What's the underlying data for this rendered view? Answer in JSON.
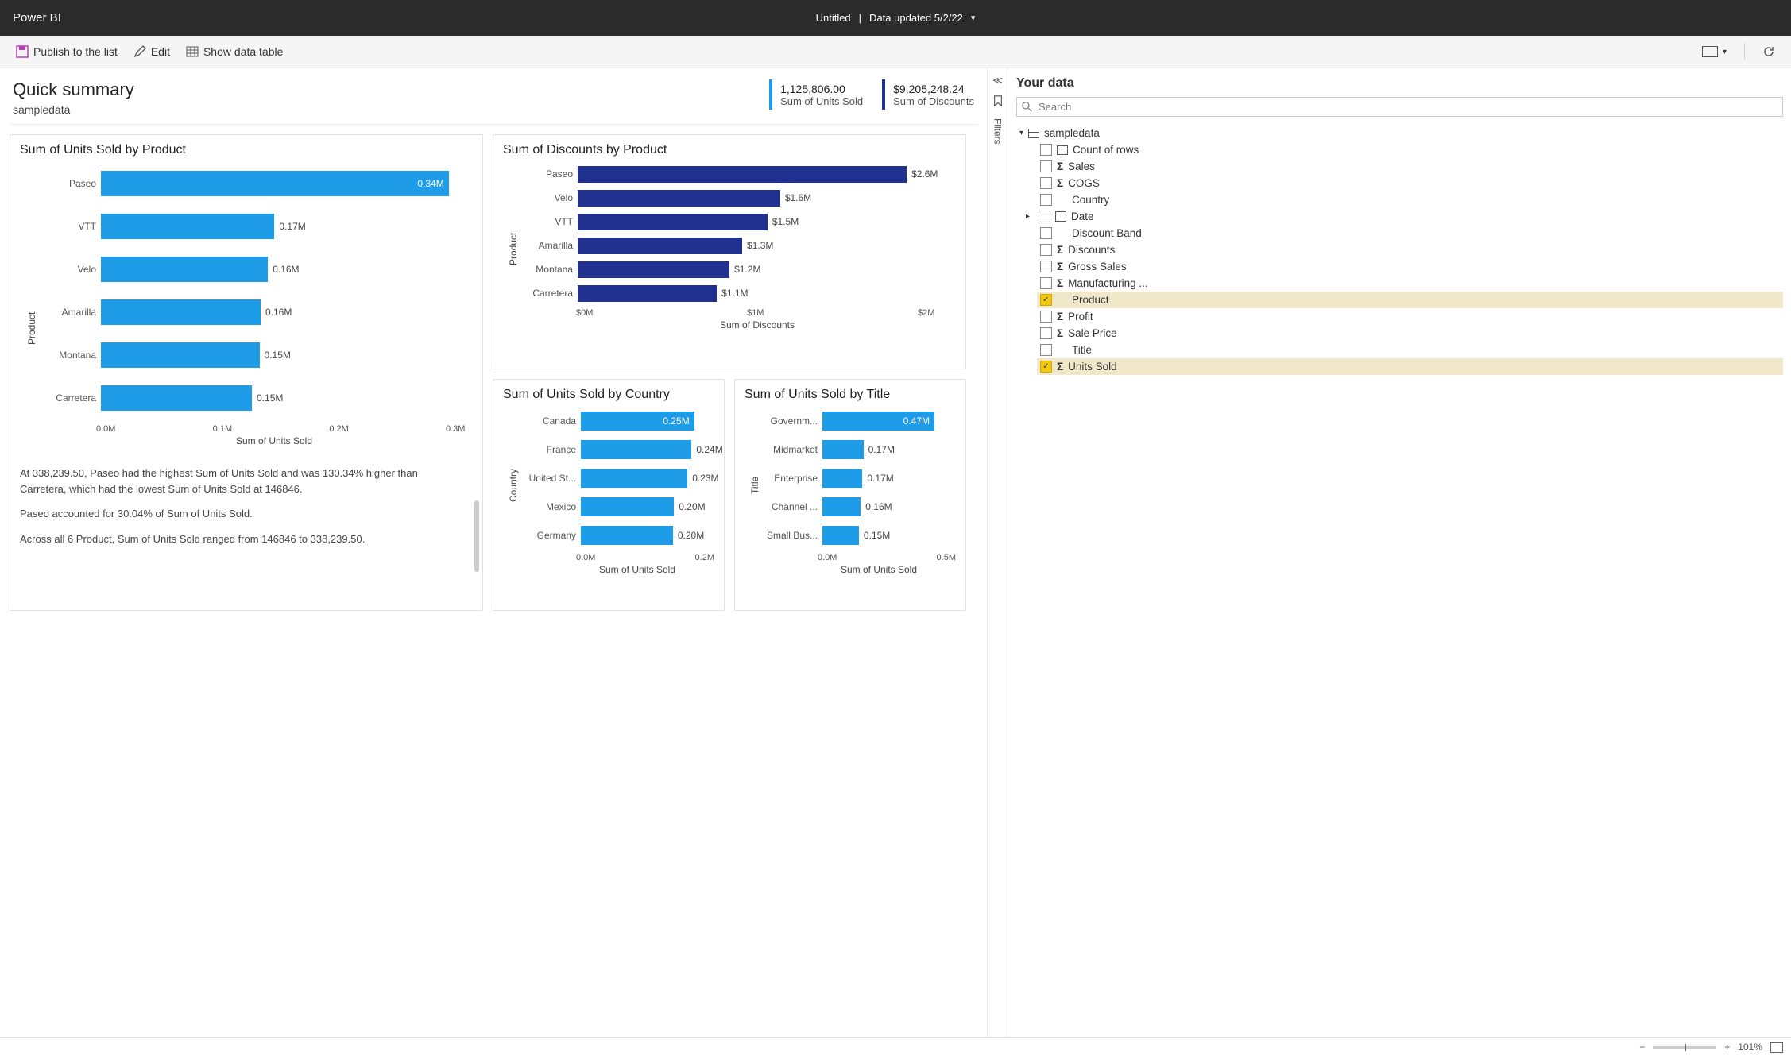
{
  "topbar": {
    "brand": "Power BI",
    "doc_title": "Untitled",
    "data_updated": "Data updated 5/2/22"
  },
  "toolbar": {
    "publish": "Publish to the list",
    "edit": "Edit",
    "show_table": "Show data table"
  },
  "summary": {
    "title": "Quick summary",
    "subtitle": "sampledata",
    "kpi1_value": "1,125,806.00",
    "kpi1_label": "Sum of Units Sold",
    "kpi2_value": "$9,205,248.24",
    "kpi2_label": "Sum of Discounts"
  },
  "charts": {
    "units_by_product_title": "Sum of Units Sold by Product",
    "discounts_by_product_title": "Sum of Discounts by Product",
    "units_by_country_title": "Sum of Units Sold by Country",
    "units_by_title_title": "Sum of Units Sold by Title"
  },
  "insights": {
    "p1": "At 338,239.50, Paseo had the highest Sum of Units Sold and was 130.34% higher than Carretera, which had the lowest Sum of Units Sold at 146846.",
    "p2": "Paseo accounted for 30.04% of Sum of Units Sold.",
    "p3": "Across all 6 Product, Sum of Units Sold ranged from 146846 to 338,239.50."
  },
  "rail": {
    "filters": "Filters"
  },
  "panel": {
    "title": "Your data",
    "search_placeholder": "Search",
    "dataset": "sampledata",
    "fields": {
      "count_rows": "Count of rows",
      "sales": "Sales",
      "cogs": "COGS",
      "country": "Country",
      "date": "Date",
      "discount_band": "Discount Band",
      "discounts": "Discounts",
      "gross_sales": "Gross Sales",
      "manufacturing": "Manufacturing ...",
      "product": "Product",
      "profit": "Profit",
      "sale_price": "Sale Price",
      "title_f": "Title",
      "units_sold": "Units Sold"
    }
  },
  "statusbar": {
    "zoom": "101%"
  },
  "colors": {
    "blue": "#1f9ce8",
    "darkblue": "#20318f"
  },
  "chart_data": [
    {
      "id": "units_by_product",
      "type": "bar",
      "orientation": "horizontal",
      "title": "Sum of Units Sold by Product",
      "ylabel": "Product",
      "xlabel": "Sum of Units Sold",
      "xlim": [
        0,
        340000
      ],
      "xticks": [
        "0.0M",
        "0.1M",
        "0.2M",
        "0.3M"
      ],
      "categories": [
        "Paseo",
        "VTT",
        "Velo",
        "Amarilla",
        "Montana",
        "Carretera"
      ],
      "values": [
        338239.5,
        168783,
        162425,
        155315,
        154198,
        146846
      ],
      "data_labels": [
        "0.34M",
        "0.17M",
        "0.16M",
        "0.16M",
        "0.15M",
        "0.15M"
      ],
      "label_inside": [
        true,
        false,
        false,
        false,
        false,
        false
      ],
      "color": "#1f9ce8"
    },
    {
      "id": "discounts_by_product",
      "type": "bar",
      "orientation": "horizontal",
      "title": "Sum of Discounts by Product",
      "ylabel": "Product",
      "xlabel": "Sum of Discounts",
      "xlim": [
        0,
        2700000
      ],
      "xticks": [
        "$0M",
        "$1M",
        "$2M"
      ],
      "categories": [
        "Paseo",
        "Velo",
        "VTT",
        "Amarilla",
        "Montana",
        "Carretera"
      ],
      "values": [
        2600000,
        1600000,
        1500000,
        1300000,
        1200000,
        1100000
      ],
      "data_labels": [
        "$2.6M",
        "$1.6M",
        "$1.5M",
        "$1.3M",
        "$1.2M",
        "$1.1M"
      ],
      "label_inside": [
        false,
        false,
        false,
        false,
        false,
        false
      ],
      "color": "#20318f"
    },
    {
      "id": "units_by_country",
      "type": "bar",
      "orientation": "horizontal",
      "title": "Sum of Units Sold by Country",
      "ylabel": "Country",
      "xlabel": "Sum of Units Sold",
      "xlim": [
        0,
        260000
      ],
      "xticks": [
        "0.0M",
        "0.2M"
      ],
      "categories": [
        "Canada",
        "France",
        "United St...",
        "Mexico",
        "Germany"
      ],
      "values": [
        247428,
        241600,
        232627,
        203325,
        200826
      ],
      "data_labels": [
        "0.25M",
        "0.24M",
        "0.23M",
        "0.20M",
        "0.20M"
      ],
      "label_inside": [
        true,
        false,
        false,
        false,
        false
      ],
      "color": "#1f9ce8"
    },
    {
      "id": "units_by_title",
      "type": "bar",
      "orientation": "horizontal",
      "title": "Sum of Units Sold by Title",
      "ylabel": "Title",
      "xlabel": "Sum of Units Sold",
      "xlim": [
        0,
        500000
      ],
      "xticks": [
        "0.0M",
        "0.5M"
      ],
      "categories": [
        "Governm...",
        "Midmarket",
        "Enterprise",
        "Channel ...",
        "Small Bus..."
      ],
      "values": [
        470000,
        172000,
        168000,
        161000,
        153000
      ],
      "data_labels": [
        "0.47M",
        "0.17M",
        "0.17M",
        "0.16M",
        "0.15M"
      ],
      "label_inside": [
        true,
        false,
        false,
        false,
        false
      ],
      "color": "#1f9ce8"
    }
  ]
}
